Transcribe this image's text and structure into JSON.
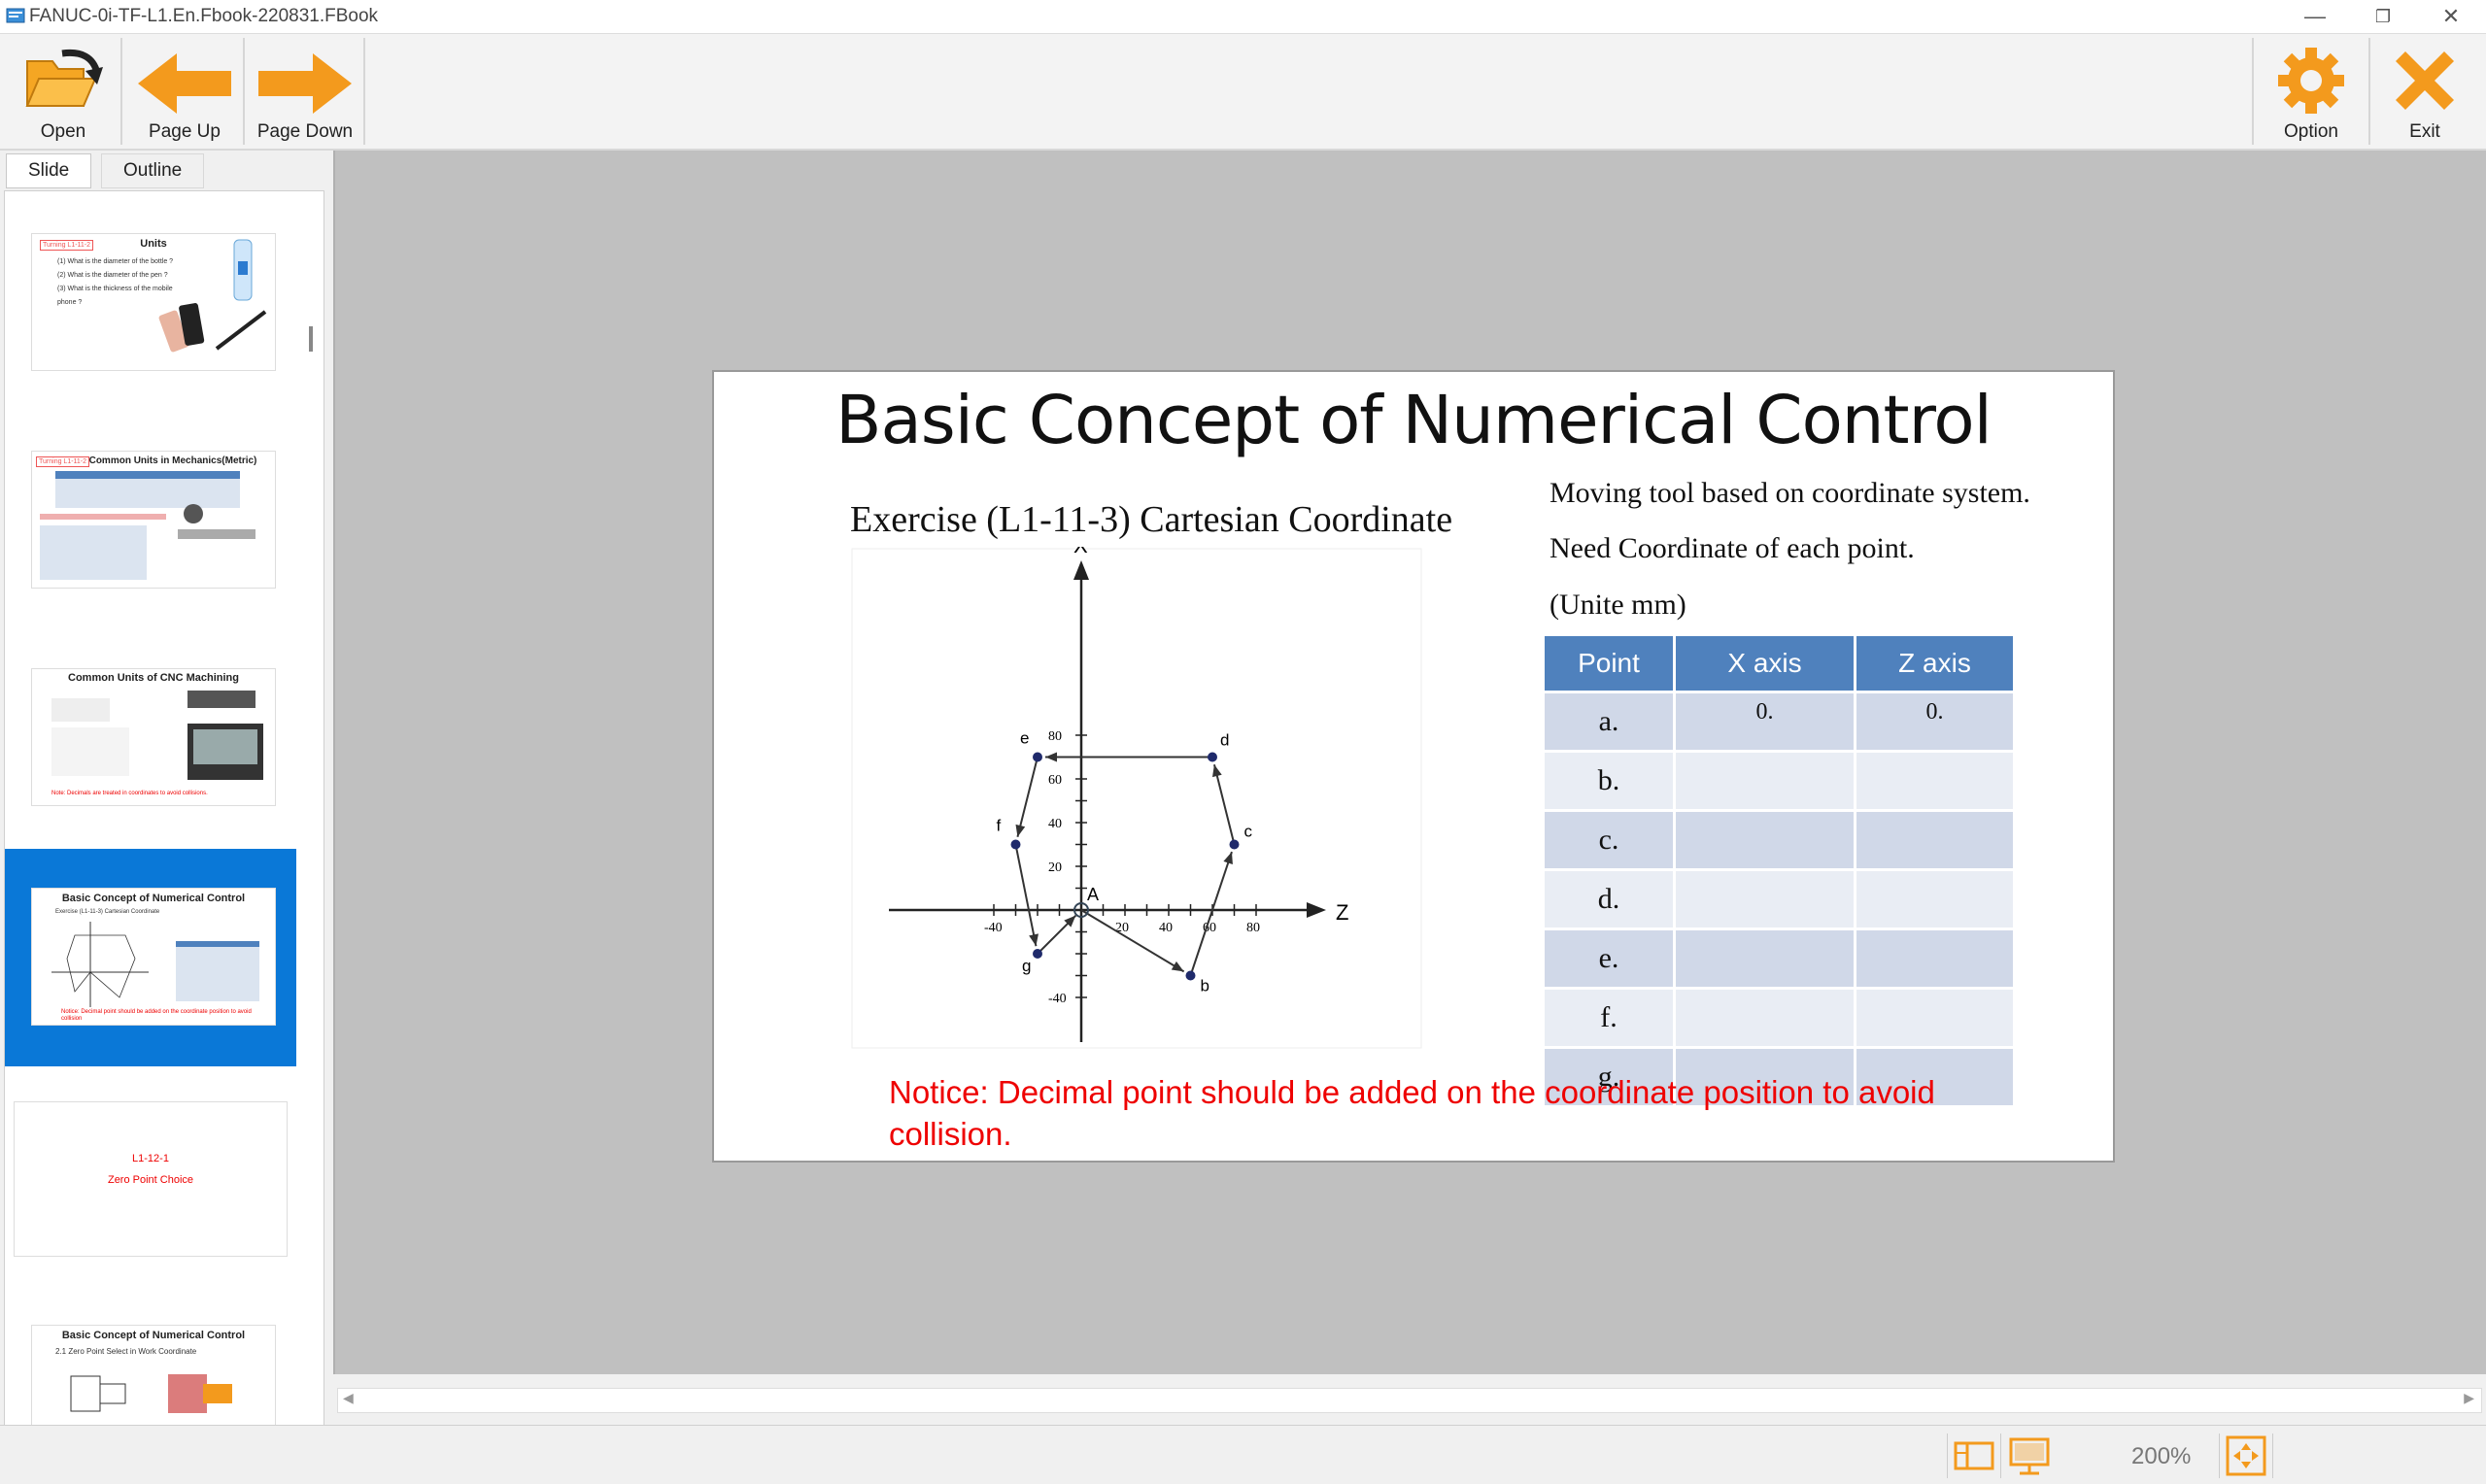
{
  "window": {
    "title": "FANUC-0i-TF-L1.En.Fbook-220831.FBook"
  },
  "toolbar": {
    "open": "Open",
    "page_up": "Page Up",
    "page_down": "Page Down",
    "option": "Option",
    "exit": "Exit"
  },
  "side_tabs": [
    "Slide",
    "Outline"
  ],
  "thumbnails": [
    {
      "title": "Units",
      "lines": [
        "(1) What is the diameter of the bottle ?",
        "(2) What is the diameter of the pen ?",
        "(3) What is the thickness of the mobile",
        "phone ?"
      ],
      "tag": "Turning L1-11-2"
    },
    {
      "title": "Common Units in Mechanics(Metric)",
      "tag": "Turning L1-11-2"
    },
    {
      "title": "Common Units of CNC Machining",
      "note": "Note: Decimals are treated in coordinates to avoid collisions."
    },
    {
      "title": "Basic Concept of Numerical Control",
      "sub": "Exercise (L1-11-3) Cartesian Coordinate",
      "note": "Notice: Decimal point should be added on the coordinate position to avoid collision",
      "selected": true
    },
    {
      "title": "L1-12-1",
      "sub": "Zero Point Choice"
    },
    {
      "title": "Basic Concept of Numerical Control",
      "sub": "2.1 Zero Point Select in Work Coordinate"
    }
  ],
  "slide": {
    "title": "Basic Concept of Numerical Control",
    "exercise_title": "Exercise (L1-11-3) Cartesian Coordinate",
    "right_lines": [
      "Moving tool based on coordinate system.",
      "Need Coordinate of each point.",
      "(Unite mm)"
    ],
    "table": {
      "headers": [
        "Point",
        "X axis",
        "Z axis"
      ],
      "rows": [
        {
          "point": "a.",
          "x": "0.",
          "z": "0."
        },
        {
          "point": "b.",
          "x": "",
          "z": ""
        },
        {
          "point": "c.",
          "x": "",
          "z": ""
        },
        {
          "point": "d.",
          "x": "",
          "z": ""
        },
        {
          "point": "e.",
          "x": "",
          "z": ""
        },
        {
          "point": "f.",
          "x": "",
          "z": ""
        },
        {
          "point": "g.",
          "x": "",
          "z": ""
        }
      ]
    },
    "notice": "Notice: Decimal point should be added on the coordinate position to avoid collision.",
    "diagram": {
      "x_axis_label": "X",
      "z_axis_label": "Z",
      "origin_label": "A",
      "z_ticks": [
        "-40",
        "20",
        "40",
        "60",
        "80"
      ],
      "x_ticks": [
        "80",
        "60",
        "40",
        "20",
        "-40"
      ],
      "points": [
        {
          "name": "a",
          "z": 0,
          "x": 0
        },
        {
          "name": "b",
          "z": 50,
          "x": -30
        },
        {
          "name": "c",
          "z": 70,
          "x": 30
        },
        {
          "name": "d",
          "z": 60,
          "x": 70
        },
        {
          "name": "e",
          "z": -20,
          "x": 70
        },
        {
          "name": "f",
          "z": -30,
          "x": 30
        },
        {
          "name": "g",
          "z": -20,
          "x": -20
        }
      ]
    }
  },
  "status": {
    "zoom": "200%"
  },
  "colors": {
    "accent_orange": "#f39a1d",
    "selection_blue": "#0a78d7",
    "table_header": "#4f81bd",
    "notice_red": "#ee0000"
  }
}
